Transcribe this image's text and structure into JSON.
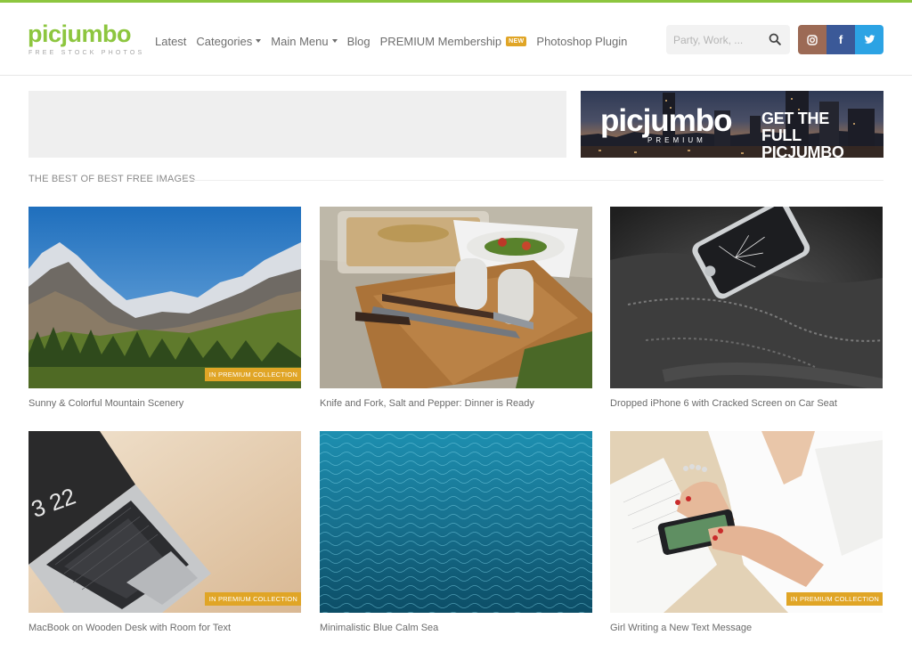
{
  "brand": {
    "logo_text": "picjumbo",
    "tagline": "FREE STOCK PHOTOS",
    "accent": "#8dc63f"
  },
  "nav": {
    "items": [
      {
        "label": "Latest",
        "has_caret": false
      },
      {
        "label": "Categories",
        "has_caret": true
      },
      {
        "label": "Main Menu",
        "has_caret": true
      },
      {
        "label": "Blog",
        "has_caret": false
      },
      {
        "label": "PREMIUM Membership",
        "badge": "NEW"
      },
      {
        "label": "Photoshop Plugin",
        "has_caret": false
      }
    ]
  },
  "search": {
    "placeholder": "Party, Work, ...",
    "icon": "search-icon"
  },
  "social": [
    {
      "name": "instagram",
      "icon": "instagram-icon",
      "color": "#9c6a55"
    },
    {
      "name": "facebook",
      "icon": "facebook-icon",
      "glyph": "f",
      "color": "#3b5998"
    },
    {
      "name": "twitter",
      "icon": "twitter-icon",
      "color": "#2ca3e4"
    }
  ],
  "banner": {
    "logo_text": "picjumbo",
    "sub_text": "PREMIUM",
    "tagline": "GET THE FULL PICJUMBO POWER"
  },
  "section": {
    "title": "THE BEST OF BEST FREE IMAGES"
  },
  "premium_badge_label": "IN PREMIUM COLLECTION",
  "photos": [
    {
      "caption": "Sunny & Colorful Mountain Scenery",
      "premium": true
    },
    {
      "caption": "Knife and Fork, Salt and Pepper: Dinner is Ready",
      "premium": false
    },
    {
      "caption": "Dropped iPhone 6 with Cracked Screen on Car Seat",
      "premium": false
    },
    {
      "caption": "MacBook on Wooden Desk with Room for Text",
      "premium": true,
      "screen_time": "3 22"
    },
    {
      "caption": "Minimalistic Blue Calm Sea",
      "premium": false
    },
    {
      "caption": "Girl Writing a New Text Message",
      "premium": true
    }
  ]
}
